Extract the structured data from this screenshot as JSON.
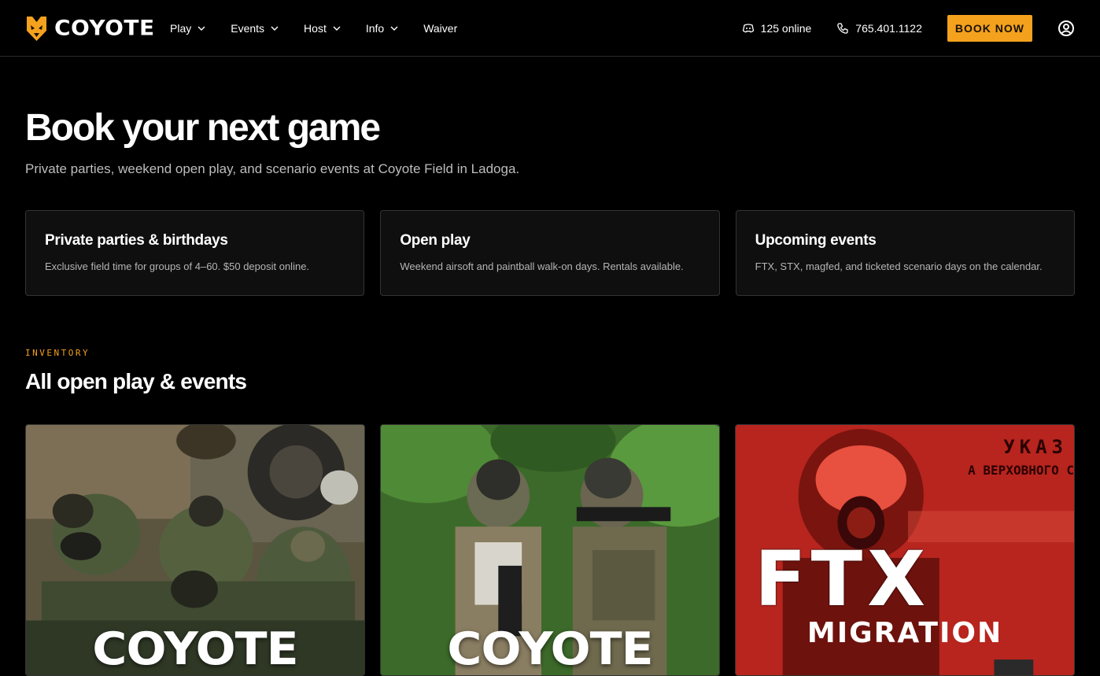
{
  "brand": {
    "name": "COYOTE",
    "accent": "#f4a11e"
  },
  "nav": {
    "items": [
      {
        "label": "Play",
        "dropdown": true
      },
      {
        "label": "Events",
        "dropdown": true
      },
      {
        "label": "Host",
        "dropdown": true
      },
      {
        "label": "Info",
        "dropdown": true
      },
      {
        "label": "Waiver",
        "dropdown": false
      }
    ]
  },
  "header": {
    "online": "125 online",
    "phone": "765.401.1122",
    "book_label": "BOOK NOW"
  },
  "hero": {
    "title": "Book your next game",
    "subtitle": "Private parties, weekend open play, and scenario events at Coyote Field in Ladoga."
  },
  "cards": [
    {
      "title": "Private parties & birthdays",
      "text": "Exclusive field time for groups of 4–60. $50 deposit online."
    },
    {
      "title": "Open play",
      "text": "Weekend airsoft and paintball walk-on days. Rentals available."
    },
    {
      "title": "Upcoming events",
      "text": "FTX, STX, magfed, and ticketed scenario days on the calendar."
    }
  ],
  "inventory": {
    "eyebrow": "INVENTORY",
    "title": "All open play & events",
    "tiles": [
      {
        "label": "COYOTE"
      },
      {
        "label": "COYOTE"
      },
      {
        "label": "FTX",
        "sublabel": "MIGRATION",
        "bg_text_1": "УКАЗ",
        "bg_text_2": "А ВЕРХОВНОГО С"
      }
    ]
  }
}
